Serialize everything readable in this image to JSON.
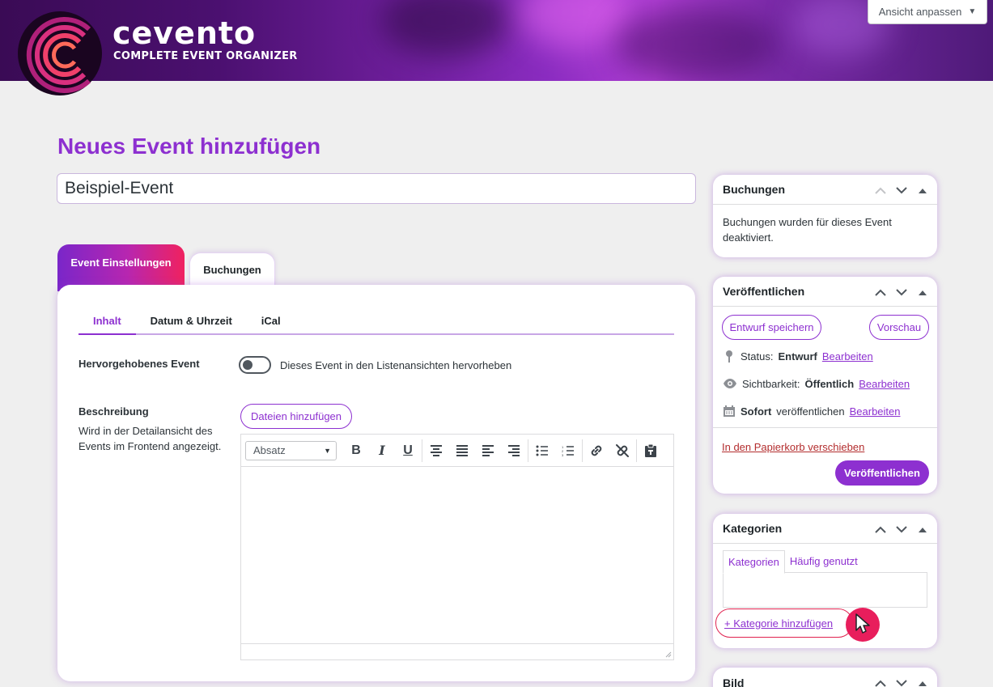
{
  "header": {
    "brand_name": "cevento",
    "brand_tagline": "COMPLETE EVENT ORGANIZER",
    "view_button": "Ansicht anpassen"
  },
  "page": {
    "title": "Neues Event hinzufügen",
    "event_title_value": "Beispiel-Event"
  },
  "main_tabs": [
    {
      "label": "Event Einstellungen",
      "active": true
    },
    {
      "label": "Buchungen",
      "active": false
    }
  ],
  "sub_tabs": [
    {
      "label": "Inhalt",
      "active": true
    },
    {
      "label": "Datum & Uhrzeit",
      "active": false
    },
    {
      "label": "iCal",
      "active": false
    }
  ],
  "featured": {
    "label": "Hervorgehobenes Event",
    "toggle_text": "Dieses Event in den Listenansichten hervorheben",
    "enabled": false
  },
  "description": {
    "label": "Beschreibung",
    "help": "Wird in der Detailansicht des Events im Frontend angezeigt.",
    "add_files": "Dateien hinzufügen",
    "format_select": "Absatz",
    "toolbar_icons": [
      "bold-icon",
      "italic-icon",
      "underline-icon",
      "align-center-icon",
      "align-justify-icon",
      "align-left-icon",
      "align-right-icon",
      "bullet-list-icon",
      "numbered-list-icon",
      "link-icon",
      "unlink-icon",
      "paste-icon"
    ]
  },
  "sidebar": {
    "bookings": {
      "title": "Buchungen",
      "text": "Buchungen wurden für dieses Event deaktiviert."
    },
    "publish": {
      "title": "Veröffentlichen",
      "save_draft": "Entwurf speichern",
      "preview": "Vorschau",
      "status_label": "Status:",
      "status_value": "Entwurf",
      "visibility_label": "Sichtbarkeit:",
      "visibility_value": "Öffentlich",
      "schedule_value": "Sofort",
      "schedule_label": "veröffentlichen",
      "edit_link": "Bearbeiten",
      "trash": "In den Papierkorb verschieben",
      "publish_button": "Veröffentlichen"
    },
    "categories": {
      "title": "Kategorien",
      "tab_all": "Kategorien",
      "tab_popular": "Häufig genutzt",
      "add_link": "+ Kategorie hinzufügen"
    },
    "image": {
      "title": "Bild"
    }
  },
  "colors": {
    "accent": "#8d30d0",
    "danger": "#b32d2e",
    "highlight": "#e81e5c"
  }
}
